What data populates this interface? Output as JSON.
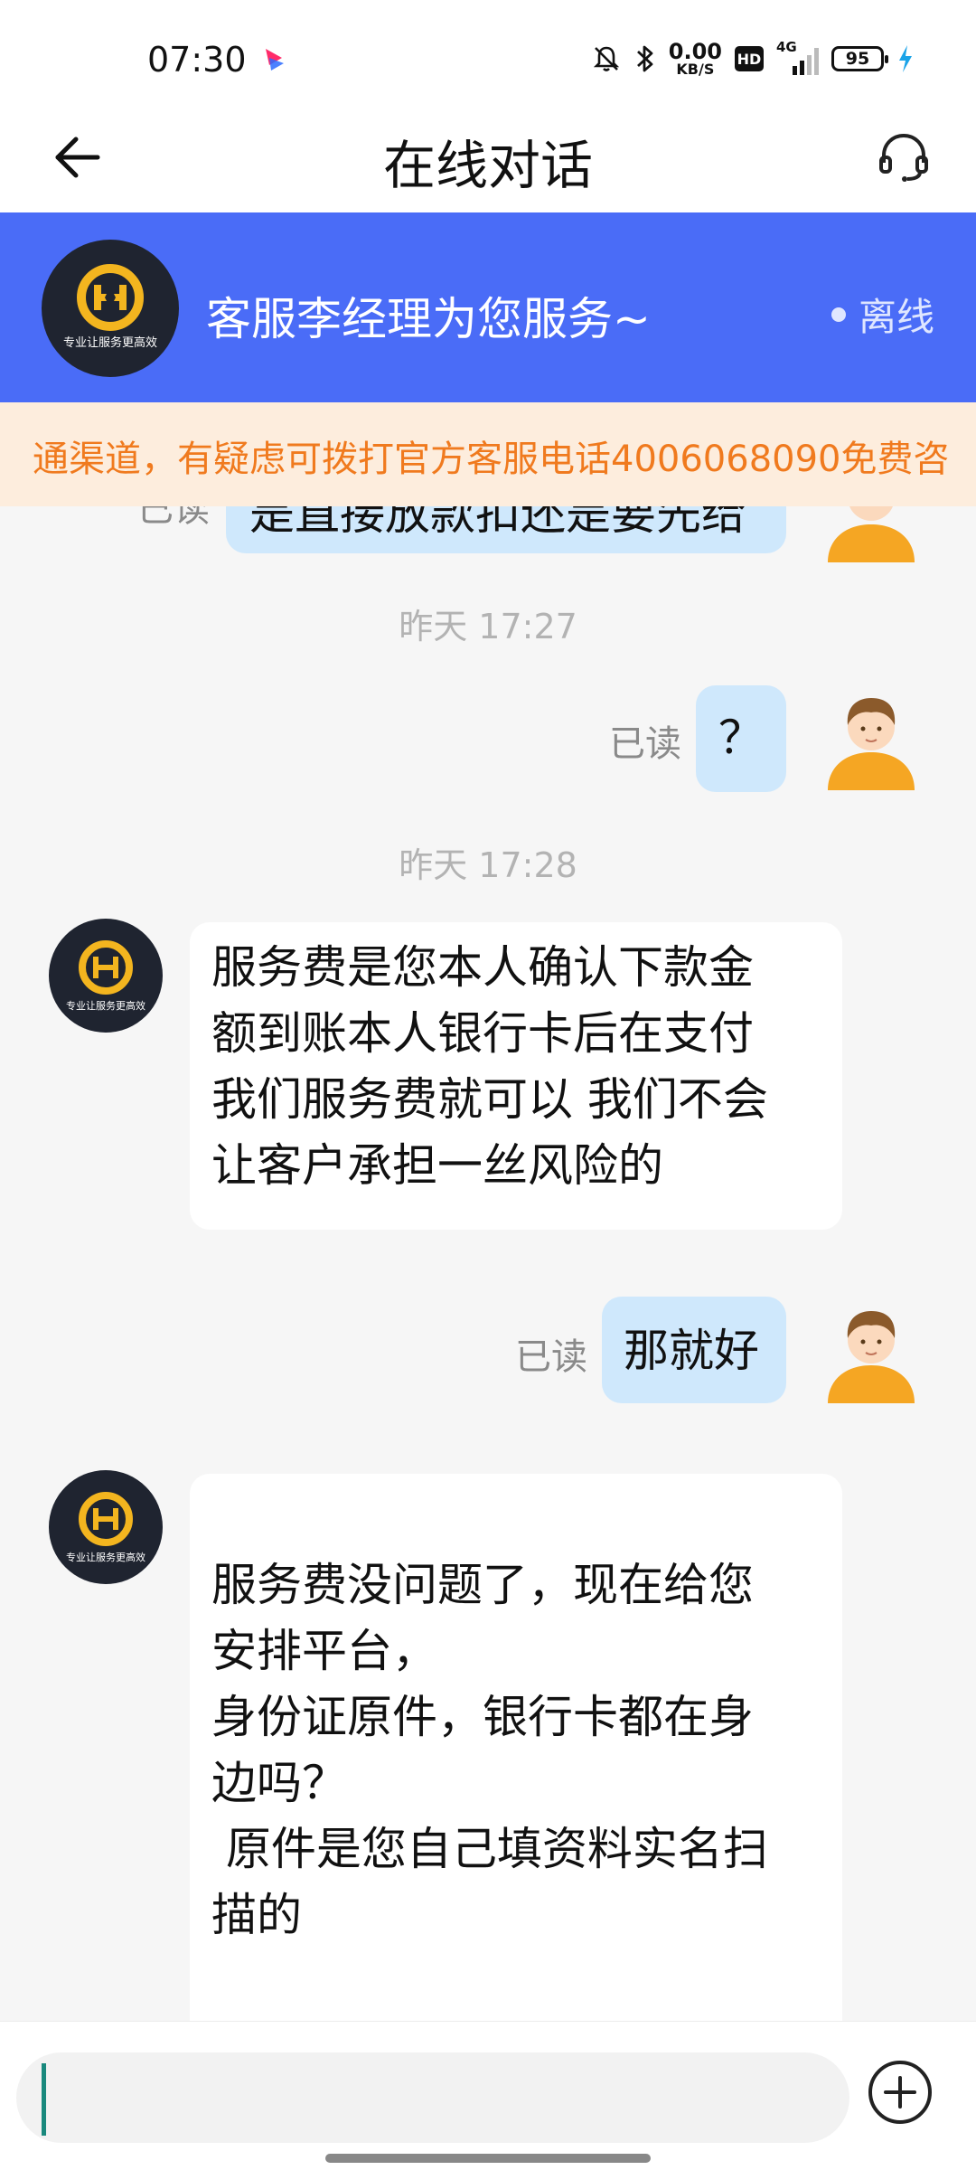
{
  "status_bar": {
    "time": "07:30",
    "net_speed_value": "0.00",
    "net_speed_unit": "KB/S",
    "hd_badge": "HD",
    "network_type": "4G",
    "battery": "95"
  },
  "nav": {
    "title": "在线对话"
  },
  "agent": {
    "logo_text": "专业让服务更高效",
    "title": "客服李经理为您服务~",
    "status": "离线"
  },
  "notice": {
    "text": "通渠道，有疑虑可拨打官方客服电话4006068090免费咨"
  },
  "messages": {
    "top_partial": {
      "read": "已读",
      "text": "是直接放款扣还是要先给"
    },
    "time1": "昨天 17:27",
    "msg_question": {
      "read": "已读",
      "text": "？"
    },
    "time2": "昨天 17:28",
    "agent_msg1": {
      "lines": [
        "服务费是您本人确认下款金",
        "额到账本人银行卡后在支付",
        "我们服务费就可以  我们不会",
        "让客户承担一丝风险的"
      ]
    },
    "msg_good": {
      "read": "已读",
      "text": "那就好"
    },
    "agent_msg2": {
      "lines": [
        "",
        "服务费没问题了，现在给您",
        "安排平台，",
        "身份证原件，银行卡都在身",
        "边吗？",
        " 原件是您自己填资料实名扫",
        "描的"
      ]
    }
  },
  "input": {
    "placeholder": ""
  },
  "colors": {
    "banner_blue": "#4a6cf7",
    "notice_bg": "#fdeddd",
    "notice_text": "#f07a1e",
    "my_bubble": "#cfe8fc",
    "agent_bubble": "#ffffff",
    "caret": "#19897d"
  },
  "icons": {
    "back": "arrow-left-icon",
    "headset": "headset-icon",
    "plus": "plus-circle-icon",
    "mute": "bell-mute-icon",
    "bluetooth": "bluetooth-icon"
  }
}
